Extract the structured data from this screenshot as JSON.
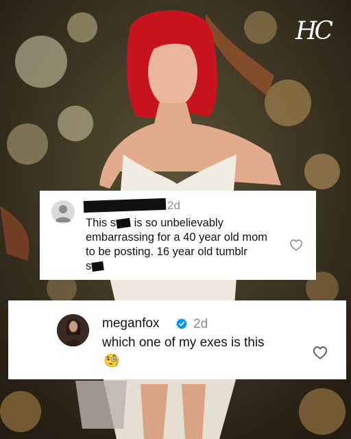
{
  "overlay": {
    "logo": "HC"
  },
  "comment1": {
    "time": "2d",
    "line1_a": "This s",
    "line1_b": " is so unbelievably",
    "line2": "embarrassing for a 40 year old mom",
    "line3": "to be posting. 16 year old tumblr",
    "line4": "s"
  },
  "comment2": {
    "username": "meganfox",
    "time": "2d",
    "text": "which one of my exes is this",
    "emoji": "🧐"
  },
  "colors": {
    "verified": "#0095f6",
    "card": "#ffffff",
    "hair": "#c8141e",
    "heart_stroke": "#8e8e8e"
  }
}
